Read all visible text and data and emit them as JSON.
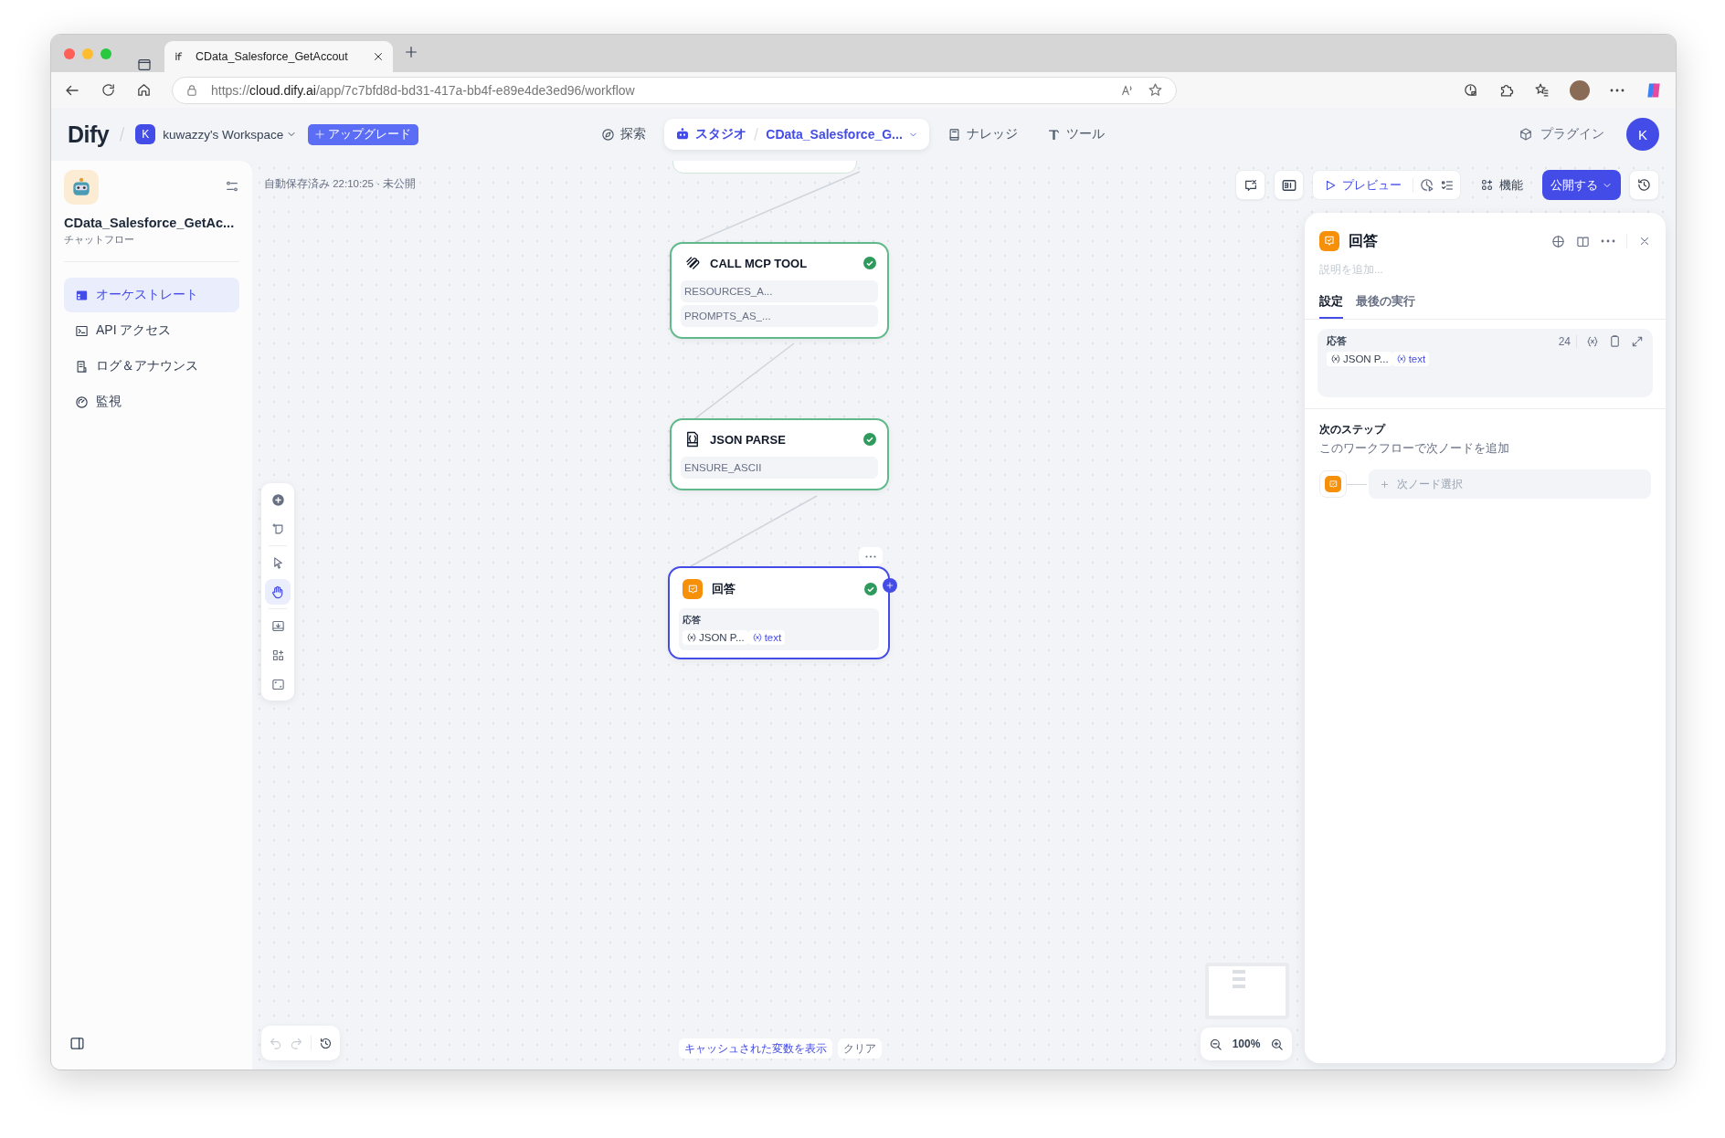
{
  "browser": {
    "tab_title": "CData_Salesforce_GetAccout",
    "url_scheme": "https://",
    "url_host": "cloud.dify.ai",
    "url_path": "/app/7c7bfd8d-bd31-417a-bb4f-e89e4de3ed96/workflow"
  },
  "header": {
    "logo": "Dify",
    "workspace_initial": "K",
    "workspace": "kuwazzy's Workspace",
    "upgrade": "アップグレード",
    "nav": [
      {
        "kind": "explore",
        "label": "探索",
        "selected": false
      },
      {
        "kind": "studio",
        "label": "スタジオ",
        "selected": true,
        "app": "CData_Salesforce_G..."
      },
      {
        "kind": "knowledge",
        "label": "ナレッジ",
        "selected": false
      },
      {
        "kind": "tools",
        "label": "ツール",
        "selected": false
      }
    ],
    "plugins": "プラグイン",
    "avatar": "K"
  },
  "sidebar": {
    "app_name": "CData_Salesforce_GetAc...",
    "app_type": "チャットフロー",
    "items": [
      {
        "kind": "orchestrate",
        "label": "オーケストレート",
        "selected": true
      },
      {
        "kind": "api",
        "label": "API アクセス",
        "selected": false
      },
      {
        "kind": "logs",
        "label": "ログ＆アナウンス",
        "selected": false
      },
      {
        "kind": "monitor",
        "label": "監視",
        "selected": false
      }
    ]
  },
  "canvas": {
    "autosave": "自動保存済み 22:10:25 · 未公開",
    "tools": [
      {
        "kind": "add",
        "selected": false
      },
      {
        "kind": "note",
        "selected": false
      },
      {
        "kind": "pointer",
        "selected": false
      },
      {
        "kind": "hand",
        "selected": true
      },
      {
        "kind": "export",
        "selected": false
      },
      {
        "kind": "organize",
        "selected": false
      },
      {
        "kind": "fit",
        "selected": false
      }
    ],
    "nodes": [
      {
        "kind": "tool",
        "title": "CALL MCP TOOL",
        "selected": false,
        "success": true,
        "fields": [
          "RESOURCES_A...",
          "PROMPTS_AS_..."
        ]
      },
      {
        "kind": "json",
        "title": "JSON PARSE",
        "selected": false,
        "success": true,
        "fields": [
          "ENSURE_ASCII"
        ]
      },
      {
        "kind": "answer",
        "title": "回答",
        "selected": true,
        "success": true,
        "label": "応答",
        "vars": [
          "JSON P...",
          "text"
        ]
      }
    ],
    "actions": {
      "preview": "プレビュー",
      "features": "機能",
      "publish": "公開する"
    },
    "cached": "キャッシュされた変数を表示",
    "clear": "クリア",
    "zoom": "100%"
  },
  "panel": {
    "title": "回答",
    "placeholder": "説明を追加...",
    "tabs": [
      {
        "label": "設定",
        "selected": true
      },
      {
        "label": "最後の実行",
        "selected": false
      }
    ],
    "field_label": "応答",
    "count": "24",
    "vars": [
      "JSON P...",
      "text"
    ],
    "next_title": "次のステップ",
    "next_desc": "このワークフローで次ノードを追加",
    "next_select": "次ノード選択"
  }
}
